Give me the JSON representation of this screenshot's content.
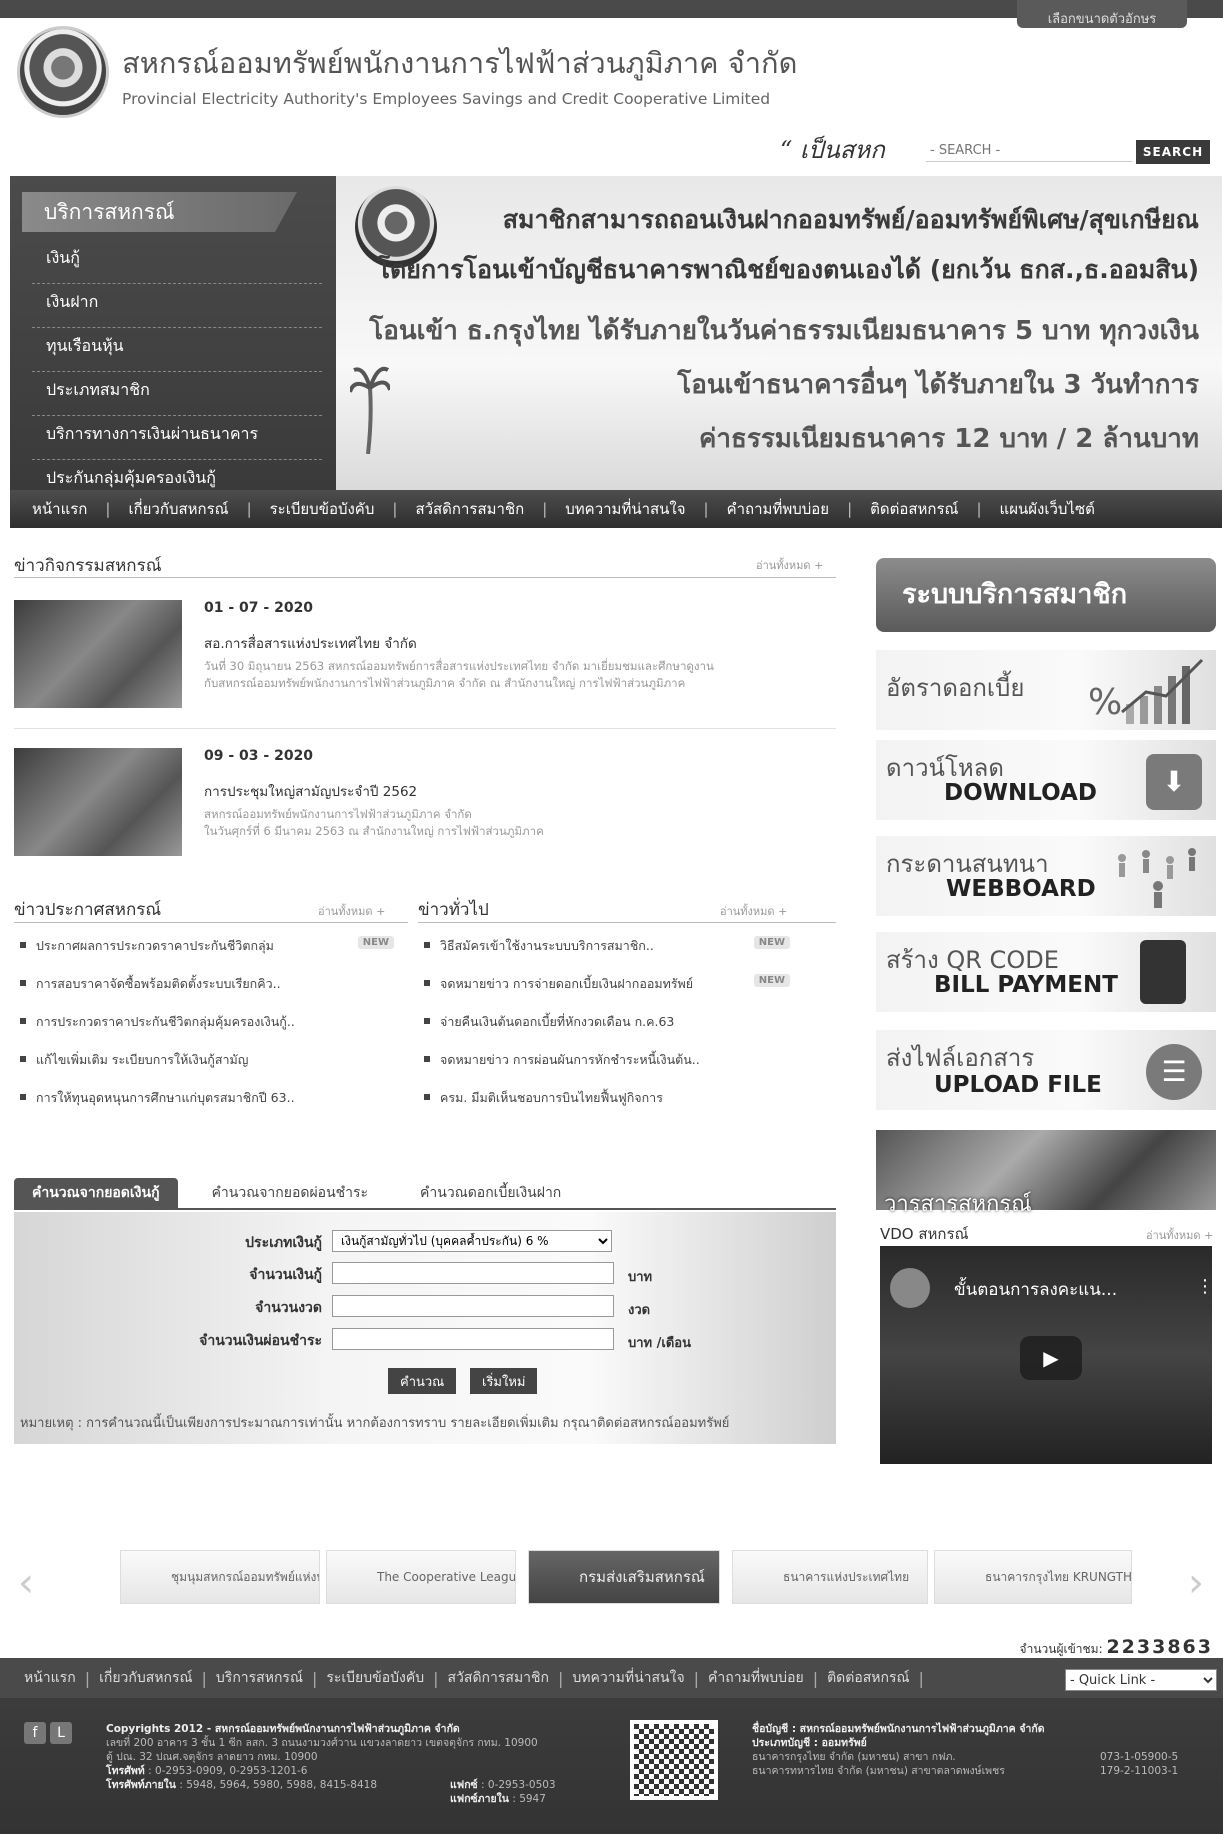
{
  "header": {
    "font_size_tab": "เลือกขนาดตัวอักษร",
    "title_th": "สหกรณ์ออมทรัพย์พนักงานการไฟฟ้าส่วนภูมิภาค จำกัด",
    "title_en": "Provincial Electricity Authority's Employees Savings and Credit Cooperative Limited",
    "slogan": "“ เป็นสหก",
    "search_placeholder": "- SEARCH -",
    "search_button": "SEARCH"
  },
  "sidemenu": {
    "title": "บริการสหกรณ์",
    "items": [
      "เงินกู้",
      "เงินฝาก",
      "ทุนเรือนหุ้น",
      "ประเภทสมาชิก",
      "บริการทางการเงินผ่านธนาคาร",
      "ประกันกลุ่มคุ้มครองเงินกู้"
    ]
  },
  "banner": {
    "line1": "สมาชิกสามารถถอนเงินฝากออมทรัพย์/ออมทรัพย์พิเศษ/สุขเกษียณ",
    "line2": "โดยการโอนเข้าบัญชีธนาคารพาณิชย์ของตนเองได้ (ยกเว้น ธกส.,ธ.ออมสิน)",
    "line3": "โอนเข้า ธ.กรุงไทย ได้รับภายในวันค่าธรรมเนียมธนาคาร 5 บาท ทุกวงเงิน",
    "line4": "โอนเข้าธนาคารอื่นๆ ได้รับภายใน 3 วันทำการ",
    "line5": "ค่าธรรมเนียมธนาคาร 12 บาท / 2 ล้านบาท"
  },
  "nav": [
    "หน้าแรก",
    "เกี่ยวกับสหกรณ์",
    "ระเบียบข้อบังคับ",
    "สวัสดิการสมาชิก",
    "บทความที่น่าสนใจ",
    "คำถามที่พบบ่อย",
    "ติดต่อสหกรณ์",
    "แผนผังเว็บไซต์"
  ],
  "activity": {
    "heading": "ข่าวกิจกรรมสหกรณ์",
    "read_all": "อ่านทั้งหมด +",
    "items": [
      {
        "date": "01 - 07 - 2020",
        "title": "สอ.การสื่อสารแห่งประเทศไทย จำกัด",
        "desc1": "วันที่ 30 มิถุนายน 2563 สหกรณ์ออมทรัพย์การสื่อสารแห่งประเทศไทย จำกัด มาเยี่ยมชมและศึกษาดูงาน",
        "desc2": "กับสหกรณ์ออมทรัพย์พนักงานการไฟฟ้าส่วนภูมิภาค จำกัด ณ สำนักงานใหญ่ การไฟฟ้าส่วนภูมิภาค"
      },
      {
        "date": "09 - 03 - 2020",
        "title": "การประชุมใหญ่สามัญประจำปี 2562",
        "desc1": "สหกรณ์ออมทรัพย์พนักงานการไฟฟ้าส่วนภูมิภาค จำกัด",
        "desc2": "ในวันศุกร์ที่ 6 มีนาคม 2563 ณ สำนักงานใหญ่ การไฟฟ้าส่วนภูมิภาค"
      }
    ]
  },
  "announce": {
    "heading": "ข่าวประกาศสหกรณ์",
    "read_all": "อ่านทั้งหมด +",
    "items": [
      "ประกาศผลการประกวดราคาประกันชีวิตกลุ่ม",
      "การสอบราคาจัดซื้อพร้อมติดตั้งระบบเรียกคิว..",
      "การประกวดราคาประกันชีวิตกลุ่มคุ้มครองเงินกู้..",
      "แก้ไขเพิ่มเติม ระเบียบการให้เงินกู้สามัญ",
      "การให้ทุนอุดหนุนการศึกษาแก่บุตรสมาชิกปี 63.."
    ],
    "badge": "NEW"
  },
  "general": {
    "heading": "ข่าวทั่วไป",
    "read_all": "อ่านทั้งหมด +",
    "items": [
      "วิธีสมัครเข้าใช้งานระบบบริการสมาชิก..",
      "จดหมายข่าว การจ่ายดอกเบี้ยเงินฝากออมทรัพย์",
      "จ่ายคืนเงินต้นดอกเบี้ยที่หักงวดเดือน ก.ค.63",
      "จดหมายข่าว การผ่อนผันการหักชำระหนี้เงินต้น..",
      "ครม. มีมติเห็นชอบการบินไทยฟื้นฟูกิจการ"
    ],
    "badge": "NEW"
  },
  "calculator": {
    "tabs": [
      "คำนวณจากยอดเงินกู้",
      "คำนวณจากยอดผ่อนชำระ",
      "คำนวณดอกเบี้ยเงินฝาก"
    ],
    "loan_type_label": "ประเภทเงินกู้",
    "loan_type_value": "เงินกู้สามัญทั่วไป (บุคคลค้ำประกัน) 6 %",
    "amount_label": "จำนวนเงินกู้",
    "amount_unit": "บาท",
    "installments_label": "จำนวนงวด",
    "installments_unit": "งวด",
    "payment_label": "จำนวนเงินผ่อนชำระ",
    "payment_unit": "บาท /เดือน",
    "calc_button": "คำนวณ",
    "reset_button": "เริ่มใหม่",
    "note": "หมายเหตุ : การคำนวณนี้เป็นเพียงการประมาณการเท่านั้น หากต้องการทราบ รายละเอียดเพิ่มเติม กรุณาติดต่อสหกรณ์ออมทรัพย์"
  },
  "right": {
    "member_system": "ระบบบริการสมาชิก",
    "interest_th": "อัตราดอกเบี้ย",
    "download_th": "ดาวน์โหลด",
    "download_en": "DOWNLOAD",
    "webboard_th": "กระดานสนทนา",
    "webboard_en": "WEBBOARD",
    "qr_th": "สร้าง QR CODE",
    "qr_en": "BILL PAYMENT",
    "upload_th": "ส่งไฟล์เอกสาร",
    "upload_en": "UPLOAD FILE",
    "journal": "วารสารสหกรณ์",
    "vdo_heading": "VDO สหกรณ์",
    "vdo_read_all": "อ่านทั้งหมด +",
    "video_title": "ขั้นตอนการลงคะแน..."
  },
  "partners": [
    "ชุมนุมสหกรณ์ออมทรัพย์แห่งประเทศไทย",
    "The Cooperative League of",
    "กรมส่งเสริมสหกรณ์",
    "ธนาคารแห่งประเทศไทย",
    "ธนาคารกรุงไทย KRUNGTHAI BANK"
  ],
  "visitor": {
    "label": "จำนวนผู้เข้าชม",
    "count": "2233863"
  },
  "footnav": [
    "หน้าแรก",
    "เกี่ยวกับสหกรณ์",
    "บริการสหกรณ์",
    "ระเบียบข้อบังคับ",
    "สวัสดิการสมาชิก",
    "บทความที่น่าสนใจ",
    "คำถามที่พบบ่อย",
    "ติดต่อสหกรณ์"
  ],
  "quicklink": "- Quick Link -",
  "footer": {
    "copyright": "Copyrights 2012 - สหกรณ์ออมทรัพย์พนักงานการไฟฟ้าส่วนภูมิภาค จำกัด",
    "address1": "เลขที่ 200 อาคาร 3 ชั้น 1 ซีก ลสก. 3 ถนนงามวงศ์วาน แขวงลาดยาว เขตจตุจักร กทม. 10900",
    "address2": "ตู้ ปณ. 32 ปณศ.จตุจักร ลาดยาว กทม. 10900",
    "phone_label": "โทรศัพท์",
    "phone": ": 0-2953-0909, 0-2953-1201-6",
    "fax_label": "แฟกซ์",
    "fax": ": 0-2953-0503",
    "internal_label": "โทรศัพท์ภายใน",
    "internal": ": 5948, 5964, 5980, 5988, 8415-8418",
    "fax_internal_label": "แฟกซ์ภายใน",
    "fax_internal": ": 5947",
    "account_name": "ชื่อบัญชี : สหกรณ์ออมทรัพย์พนักงานการไฟฟ้าส่วนภูมิภาค จำกัด",
    "account_type": "ประเภทบัญชี : ออมทรัพย์",
    "bank1": "ธนาคารกรุงไทย จำกัด (มหาชน)   สาขา กฟภ.",
    "bank1_no": "073-1-05900-5",
    "bank2": "ธนาคารทหารไทย จำกัด (มหาชน) สาขาตลาดพงษ์เพชร",
    "bank2_no": "179-2-11003-1"
  }
}
